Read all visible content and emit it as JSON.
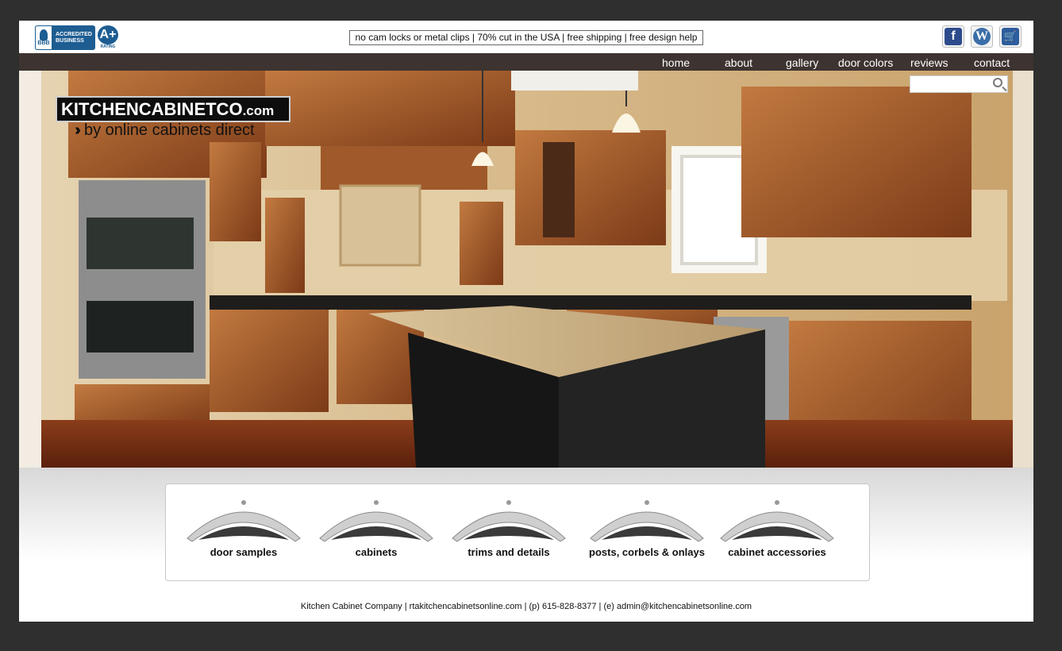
{
  "badge": {
    "bbb_text_1": "ACCREDITED",
    "bbb_text_2": "BUSINESS",
    "bbb_logo": "BBB",
    "grade": "A+",
    "grade_label": "RATING"
  },
  "promo": "no cam locks or metal clips | 70% cut in the USA | free shipping | free design help",
  "social": {
    "facebook": "f",
    "wordpress": "W",
    "cart": "🛒"
  },
  "nav": [
    "home",
    "about",
    "gallery",
    "door colors",
    "reviews",
    "contact"
  ],
  "logo": {
    "main": "KITCHENCABINETCO",
    "domain": ".com",
    "tagline": "by online cabinets direct"
  },
  "search": {
    "placeholder": ""
  },
  "categories": [
    "door samples",
    "cabinets",
    "trims and details",
    "posts, corbels & onlays",
    "cabinet accessories"
  ],
  "footer": "Kitchen Cabinet Company | rtakitchencabinetsonline.com |  (p) 615-828-8377 | (e) admin@kitchencabinetsonline.com",
  "colors": {
    "nav_bg": "#3d3330",
    "bbb_blue": "#1d5d92",
    "background": "#2f2f2f"
  }
}
